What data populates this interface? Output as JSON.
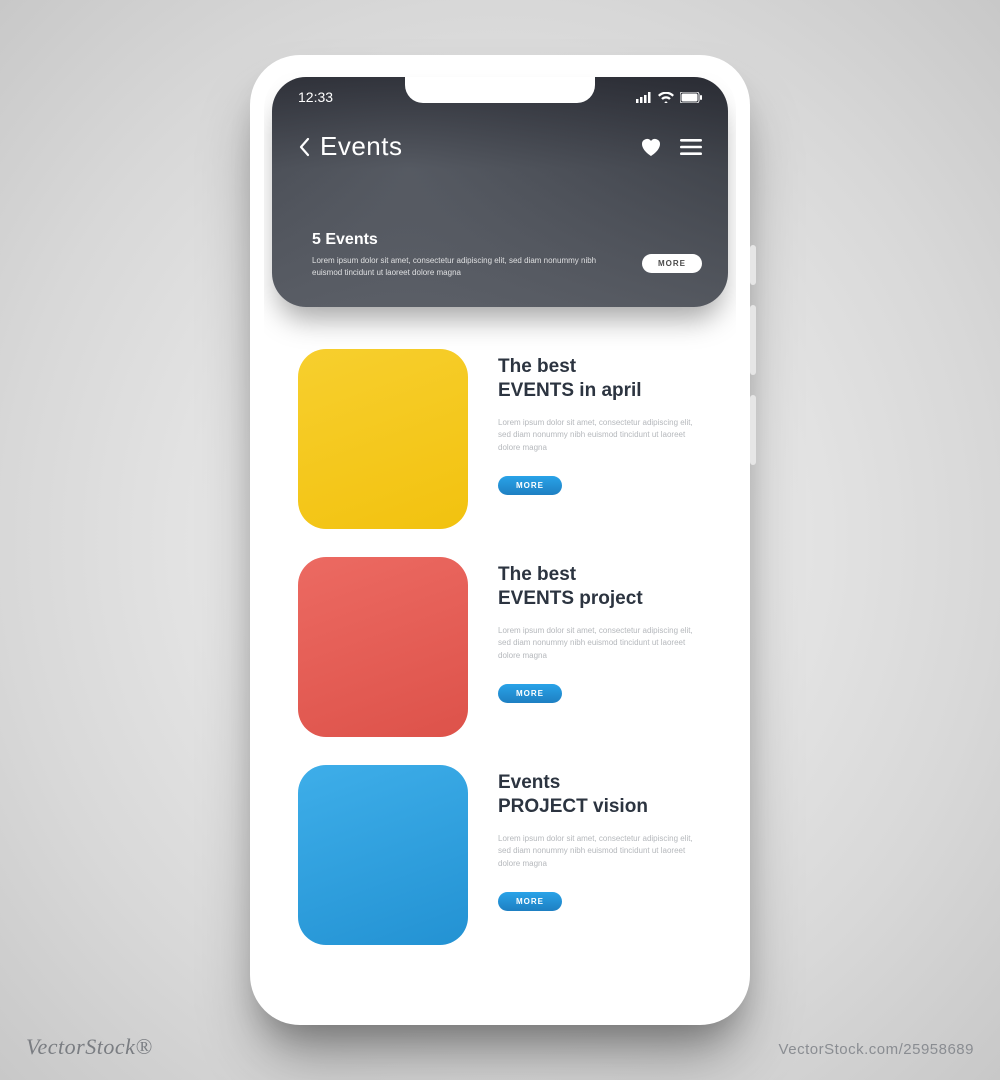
{
  "status": {
    "time": "12:33"
  },
  "nav": {
    "title": "Events"
  },
  "hero": {
    "title": "5 Events",
    "desc": "Lorem ipsum dolor sit amet, consectetur adipiscing elit, sed diam nonummy nibh euismod tincidunt ut laoreet dolore magna",
    "more": "MORE"
  },
  "items": [
    {
      "title_l1": "The best",
      "title_l2": "EVENTS in april",
      "desc": "Lorem ipsum dolor sit amet, consectetur adipiscing elit, sed diam nonummy nibh euismod tincidunt ut laoreet dolore magna",
      "more": "MORE",
      "color": "yellow"
    },
    {
      "title_l1": "The best",
      "title_l2": "EVENTS project",
      "desc": "Lorem ipsum dolor sit amet, consectetur adipiscing elit, sed diam nonummy nibh euismod tincidunt ut laoreet dolore magna",
      "more": "MORE",
      "color": "red"
    },
    {
      "title_l1": "Events",
      "title_l2": "PROJECT vision",
      "desc": "Lorem ipsum dolor sit amet, consectetur adipiscing elit, sed diam nonummy nibh euismod tincidunt ut laoreet dolore magna",
      "more": "MORE",
      "color": "blue"
    }
  ],
  "watermark": {
    "left": "VectorStock®",
    "right": "VectorStock.com/25958689"
  },
  "colors": {
    "yellow": "#f4c817",
    "red": "#e45a52",
    "blue": "#2d9bda",
    "accent_button": "#1e8fd4"
  }
}
